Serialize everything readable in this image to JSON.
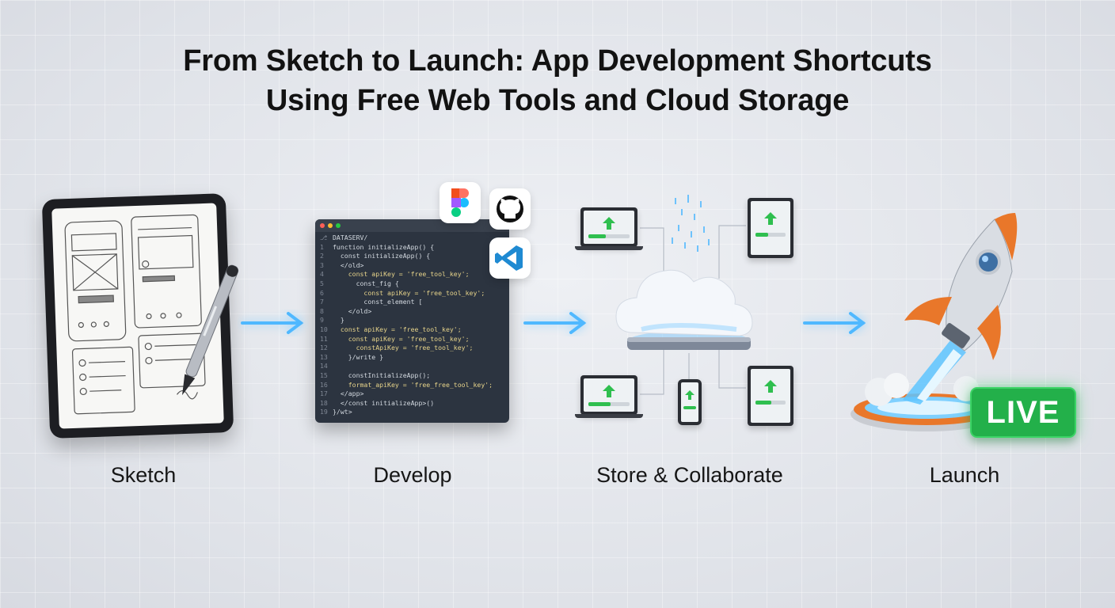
{
  "title": {
    "line1": "From Sketch to Launch: App Development Shortcuts",
    "line2": "Using Free Web Tools and Cloud Storage"
  },
  "stages": [
    {
      "label": "Sketch"
    },
    {
      "label": "Develop"
    },
    {
      "label": "Store & Collaborate"
    },
    {
      "label": "Launch"
    }
  ],
  "badge": {
    "text": "LIVE"
  },
  "tool_icons": [
    "figma-icon",
    "github-icon",
    "vscode-icon"
  ],
  "colors": {
    "arrow_glow": "#4fb8ff",
    "live_badge": "#23b04a",
    "rocket_accent": "#e9772a",
    "upload_green": "#2fbf4f"
  },
  "editor": {
    "header": "DATASERV/",
    "lines": [
      {
        "n": "1",
        "text": "function initializeApp() {"
      },
      {
        "n": "2",
        "text": "  const initializeApp() {"
      },
      {
        "n": "3",
        "text": "  </old>"
      },
      {
        "n": "4",
        "text": "    const apiKey = 'free_tool_key';"
      },
      {
        "n": "5",
        "text": "      const_fig {"
      },
      {
        "n": "6",
        "text": "        const apiKey = 'free_tool_key';"
      },
      {
        "n": "7",
        "text": "        const_element ["
      },
      {
        "n": "8",
        "text": "    </old>"
      },
      {
        "n": "9",
        "text": "  }"
      },
      {
        "n": "10",
        "text": "  const apiKey = 'free_tool_key';"
      },
      {
        "n": "11",
        "text": "    const apiKey = 'free_tool_key';"
      },
      {
        "n": "12",
        "text": "      constApiKey = 'free_tool_key';"
      },
      {
        "n": "13",
        "text": "    }/write }"
      },
      {
        "n": "14",
        "text": ""
      },
      {
        "n": "15",
        "text": "    constInitializeApp();"
      },
      {
        "n": "16",
        "text": "    format_apiKey = 'free_free_tool_key';"
      },
      {
        "n": "17",
        "text": "  </app>"
      },
      {
        "n": "18",
        "text": "  </const initializeApp>()"
      },
      {
        "n": "19",
        "text": "}/wt>"
      }
    ]
  }
}
